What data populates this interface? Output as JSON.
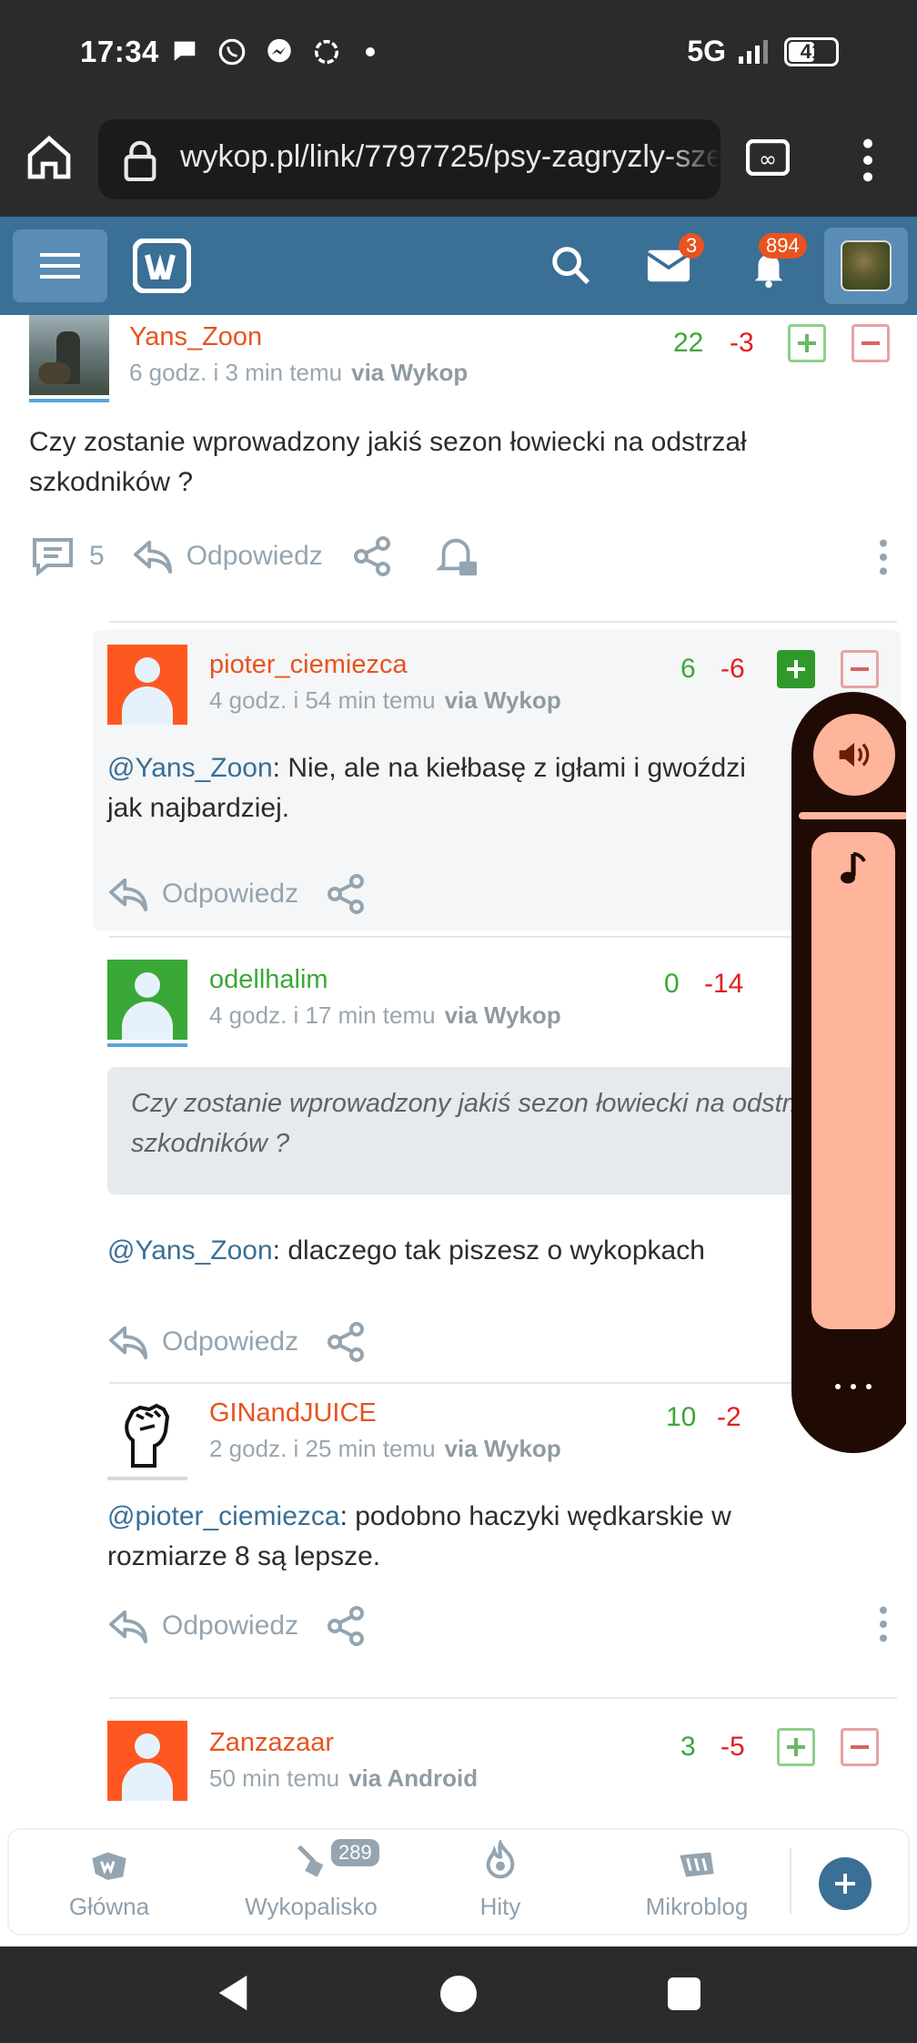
{
  "status_bar": {
    "time": "17:34",
    "network": "5G",
    "battery": "41"
  },
  "browser": {
    "url": "wykop.pl/link/7797725/psy-zagryzly-sze"
  },
  "header": {
    "mail_count": "3",
    "notifications_count": "894"
  },
  "comments": [
    {
      "author": "Yans_Zoon",
      "time": "6 godz. i 3 min temu",
      "via": "via Wykop",
      "votes_plus": "22",
      "votes_minus": "-3",
      "text": "Czy zostanie wprowadzony jakiś sezon łowiecki na odstrzał szkodników ?",
      "replies_count": "5",
      "reply_label": "Odpowiedz"
    },
    {
      "author": "pioter_ciemiezca",
      "time": "4 godz. i 54 min temu",
      "via": "via Wykop",
      "votes_plus": "6",
      "votes_minus": "-6",
      "mention": "@Yans_Zoon",
      "text": ": Nie, ale na kiełbasę z igłami i gwoździ",
      "text2": "jak najbardziej.",
      "reply_label": "Odpowiedz"
    },
    {
      "author": "odellhalim",
      "time": "4 godz. i 17 min temu",
      "via": "via Wykop",
      "votes_plus": "0",
      "votes_minus": "-14",
      "quote": "Czy zostanie wprowadzony jakiś sezon łowiecki na odstrzał szkodników ?",
      "mention": "@Yans_Zoon",
      "text": ": dlaczego tak piszesz o wykopkach",
      "reply_label": "Odpowiedz"
    },
    {
      "author": "GINandJUICE",
      "time": "2 godz. i 25 min temu",
      "via": "via Wykop",
      "votes_plus": "10",
      "votes_minus": "-2",
      "mention": "@pioter_ciemiezca",
      "text": ": podobno haczyki wędkarskie w rozmiarze 8 są lepsze.",
      "reply_label": "Odpowiedz"
    },
    {
      "author": "Zanzazaar",
      "time": "50 min temu",
      "via": "via Android",
      "votes_plus": "3",
      "votes_minus": "-5"
    }
  ],
  "bottom_nav": {
    "home": "Główna",
    "wykopalisko": "Wykopalisko",
    "wykopalisko_badge": "289",
    "hits": "Hity",
    "microblog": "Mikroblog"
  },
  "colors": {
    "brand_blue": "#3a6f96",
    "orange_author": "#e8531f",
    "green_author": "#3aa836",
    "vote_plus": "#3aa836",
    "vote_minus": "#e0201f",
    "volume_accent": "#ffb59c"
  },
  "icons": [
    "home-icon",
    "lock-icon",
    "tabs-icon",
    "menu-icon",
    "search-icon",
    "mail-icon",
    "bell-icon",
    "comment-icon",
    "reply-icon",
    "share-icon",
    "bell-subscribe-icon",
    "volume-icon",
    "music-note-icon",
    "back-icon"
  ]
}
